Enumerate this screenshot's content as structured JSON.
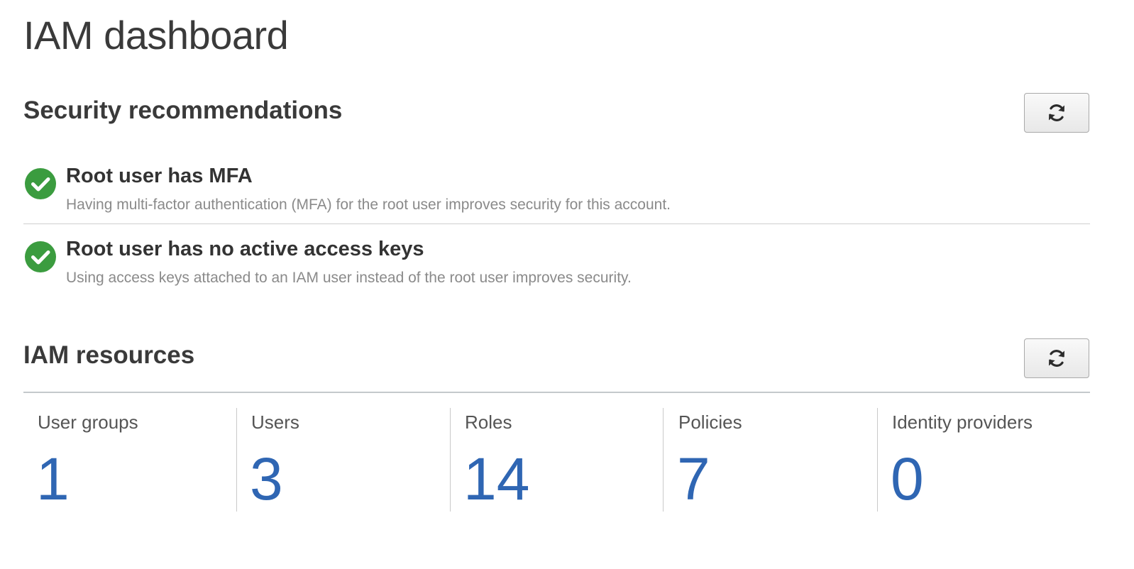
{
  "page": {
    "title": "IAM dashboard"
  },
  "security": {
    "title": "Security recommendations",
    "refresh_icon": "refresh-icon",
    "items": [
      {
        "status": "success",
        "icon": "check-circle-icon",
        "title": "Root user has MFA",
        "description": "Having multi-factor authentication (MFA) for the root user improves security for this account."
      },
      {
        "status": "success",
        "icon": "check-circle-icon",
        "title": "Root user has no active access keys",
        "description": "Using access keys attached to an IAM user instead of the root user improves security."
      }
    ]
  },
  "resources": {
    "title": "IAM resources",
    "refresh_icon": "refresh-icon",
    "tiles": [
      {
        "label": "User groups",
        "count": "1"
      },
      {
        "label": "Users",
        "count": "3"
      },
      {
        "label": "Roles",
        "count": "14"
      },
      {
        "label": "Policies",
        "count": "7"
      },
      {
        "label": "Identity providers",
        "count": "0"
      }
    ]
  },
  "colors": {
    "success": "#3b9c3f",
    "link": "#2f66b3",
    "heading": "#3a3a3a",
    "muted": "#8a8a8a"
  }
}
